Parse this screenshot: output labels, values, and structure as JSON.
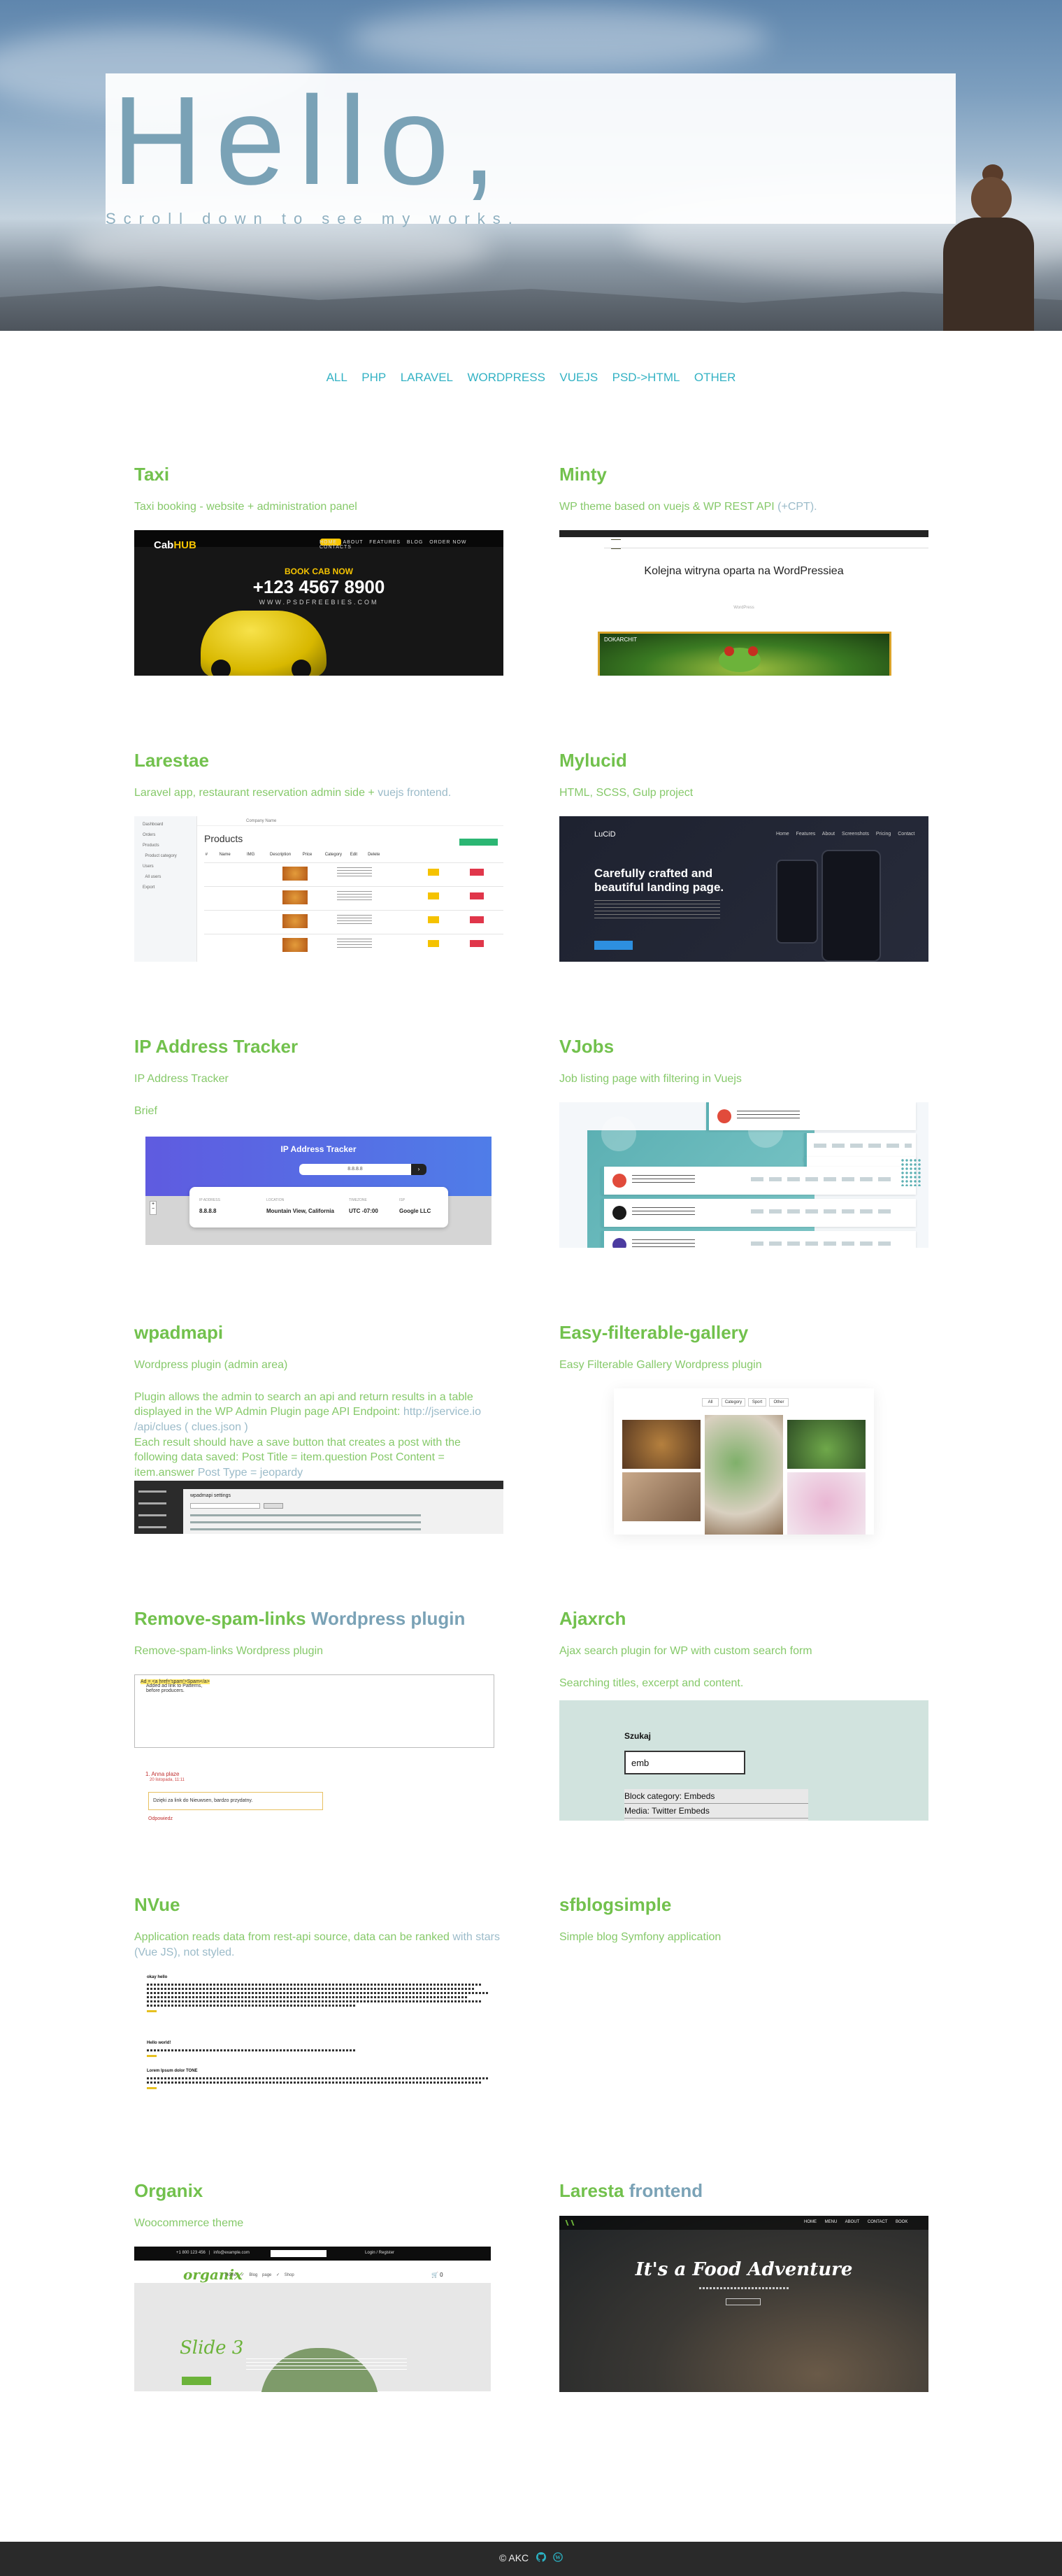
{
  "hero": {
    "title": "Hello,",
    "subtitle": "Scroll down to see my works."
  },
  "filters": [
    "ALL",
    "PHP",
    "LARAVEL",
    "WORDPRESS",
    "VUEJS",
    "PSD->HTML",
    "OTHER"
  ],
  "projects": [
    {
      "title": "Taxi",
      "desc": "Taxi booking - website + administration panel",
      "thumb": {
        "logo_a": "Cab",
        "logo_b": "HUB",
        "cta": "BOOK CAB NOW",
        "phone": "+123 4567 8900",
        "web": "WWW.PSDFREEBIES.COM"
      }
    },
    {
      "title": "Minty",
      "desc_a": "WP theme based on vuejs & WP REST API",
      "desc_b": " (+CPT).",
      "thumb": {
        "heading": "Kolejna witryna oparta na WordPressiea",
        "pic_label": "DOKARCHIT"
      }
    },
    {
      "title": "Larestae",
      "desc_a": "Laravel app, restaurant reservation admin side + ",
      "desc_b": "vuejs frontend.",
      "thumb": {
        "heading": "Products"
      }
    },
    {
      "title": "Mylucid",
      "desc": "HTML, SCSS, Gulp project",
      "thumb": {
        "logo": "LuCiD",
        "nav": "Home Features About Screenshots Pricing Contact",
        "heading": "Carefully crafted and beautiful landing page."
      }
    },
    {
      "title": "IP Address Tracker",
      "desc": "IP Address Tracker",
      "extra": "Brief",
      "thumb": {
        "heading": "IP Address Tracker",
        "input": "8.8.8.8",
        "cells": [
          {
            "label": "IP ADDRESS",
            "value": "8.8.8.8"
          },
          {
            "label": "LOCATION",
            "value": "Mountain View, California"
          },
          {
            "label": "TIMEZONE",
            "value": "UTC -07:00"
          },
          {
            "label": "ISP",
            "value": "Google LLC"
          }
        ]
      }
    },
    {
      "title": "VJobs",
      "desc": "Job listing page with filtering in Vuejs",
      "thumb": {
        "logos": [
          "#e14b3b",
          "#1a1a1a",
          "#4b3ba0"
        ]
      }
    },
    {
      "title": "wpadmapi",
      "desc": "Wordpress plugin (admin area)",
      "extra_a": "Plugin allows the admin to search an api and return results in a table displayed in the WP Admin Plugin page API Endpoint: ",
      "extra_b": "http://jservice.io /api/clues ( clues.json )",
      "extra_c": "Each result should have a save button that creates a post with the following data saved: Post Title = item.question Post Content = item.answer ",
      "extra_d": "Post Type = jeopardy",
      "thumb": {
        "heading": "wpadmapi settings"
      }
    },
    {
      "title": "Easy-filterable-gallery",
      "desc": "Easy Filterable Gallery Wordpress plugin",
      "thumb": {
        "tabs": [
          "All",
          "Category",
          "Sport",
          "Other"
        ]
      }
    },
    {
      "title_a": "Remove-spam-links ",
      "title_b": "Wordpress plugin",
      "desc": "Remove-spam-links Wordpress plugin",
      "thumb": {
        "textarea": "Added ad link to Patterns, before producers. ",
        "textarea_hl": "Ad = <a href='spam'>Spam</a>",
        "comment_author": "1. Anna plaze",
        "comment_date": "20 listopada, 11:11",
        "comment_text": "Dzięki za link do Nieuwsen, bardzo przydatny.",
        "comment_action": "Odpowiedz"
      }
    },
    {
      "title": "Ajaxrch",
      "desc": "Ajax search plugin for WP with custom search form",
      "extra": "Searching titles, excerpt and content.",
      "thumb": {
        "label": "Szukaj",
        "input": "emb",
        "suggestions": [
          "Block category: Embeds",
          "Media: Twitter Embeds"
        ]
      }
    },
    {
      "title": "NVue",
      "desc_a": "Application reads data from rest-api source, data can be ranked ",
      "desc_b": "with stars (Vue JS), not styled.",
      "thumb": {
        "headings": [
          "okay hello",
          "Hello world!",
          "Lorem Ipsum dolor TONE"
        ]
      }
    },
    {
      "title": "sfblogsimple",
      "desc": "Simple blog Symfony application"
    },
    {
      "title": "Organix",
      "desc": "Woocommerce theme",
      "thumb": {
        "logo": "organix",
        "nav": "Home ✓ Blog page ✓ Shop",
        "slide": "Slide 3",
        "cart": "🛒 0"
      }
    },
    {
      "title_a": "Laresta ",
      "title_b": "frontend",
      "thumb": {
        "nav": "HOME MENU ABOUT CONTACT BOOK",
        "heading": "It's a Food Adventure"
      }
    }
  ],
  "footer": {
    "copy": "© AKC",
    "icons": [
      "github-icon",
      "wordpress-icon"
    ]
  },
  "colors": {
    "green": "#72c14d",
    "teal": "#33b2c4",
    "muted_blue": "#7aa2b6",
    "footer_bg": "#2a2a2a"
  }
}
